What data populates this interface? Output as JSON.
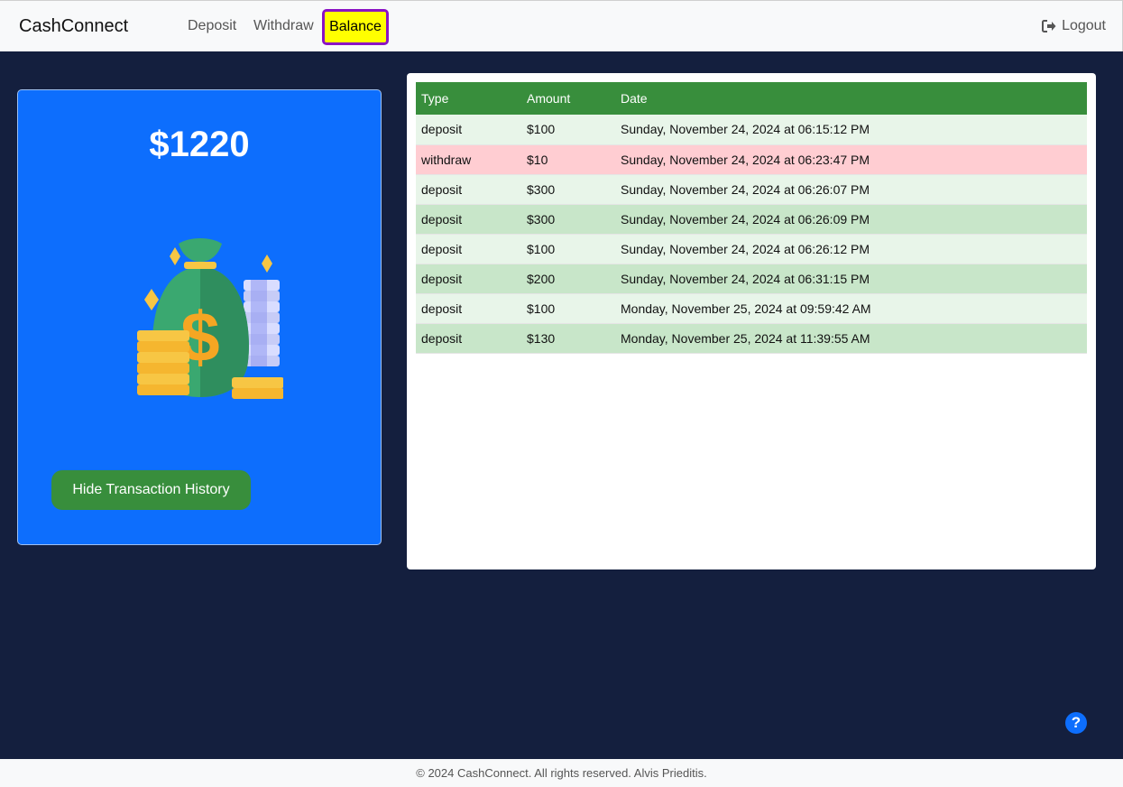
{
  "nav": {
    "brand": "CashConnect",
    "deposit": "Deposit",
    "withdraw": "Withdraw",
    "balance": "Balance",
    "logout": "Logout",
    "logout_icon": "sign-out-icon"
  },
  "balance_card": {
    "amount": "$1220",
    "image": "money-bag-icon",
    "toggle_button": "Hide Transaction History"
  },
  "transactions": {
    "headers": [
      "Type",
      "Amount",
      "Date"
    ],
    "rows": [
      {
        "type": "deposit",
        "amount": "$100",
        "date": "Sunday, November 24, 2024 at 06:15:12 PM"
      },
      {
        "type": "withdraw",
        "amount": "$10",
        "date": "Sunday, November 24, 2024 at 06:23:47 PM"
      },
      {
        "type": "deposit",
        "amount": "$300",
        "date": "Sunday, November 24, 2024 at 06:26:07 PM"
      },
      {
        "type": "deposit",
        "amount": "$300",
        "date": "Sunday, November 24, 2024 at 06:26:09 PM"
      },
      {
        "type": "deposit",
        "amount": "$100",
        "date": "Sunday, November 24, 2024 at 06:26:12 PM"
      },
      {
        "type": "deposit",
        "amount": "$200",
        "date": "Sunday, November 24, 2024 at 06:31:15 PM"
      },
      {
        "type": "deposit",
        "amount": "$100",
        "date": "Monday, November 25, 2024 at 09:59:42 AM"
      },
      {
        "type": "deposit",
        "amount": "$130",
        "date": "Monday, November 25, 2024 at 11:39:55 AM"
      }
    ]
  },
  "help": {
    "icon": "question-circle-icon",
    "glyph": "?"
  },
  "footer": {
    "text": "© 2024 CashConnect. All rights reserved. Alvis Prieditis."
  },
  "colors": {
    "navbar_bg": "#f8f9fa",
    "page_bg": "#141f3e",
    "card_bg": "#0d6efd",
    "table_header": "#388e3c",
    "deposit_row_light": "#e8f5e9",
    "deposit_row_dark": "#c8e6c9",
    "withdraw_row": "#ffcdd2",
    "active_nav_bg": "#ffff00",
    "active_nav_border": "#8a13c4"
  }
}
